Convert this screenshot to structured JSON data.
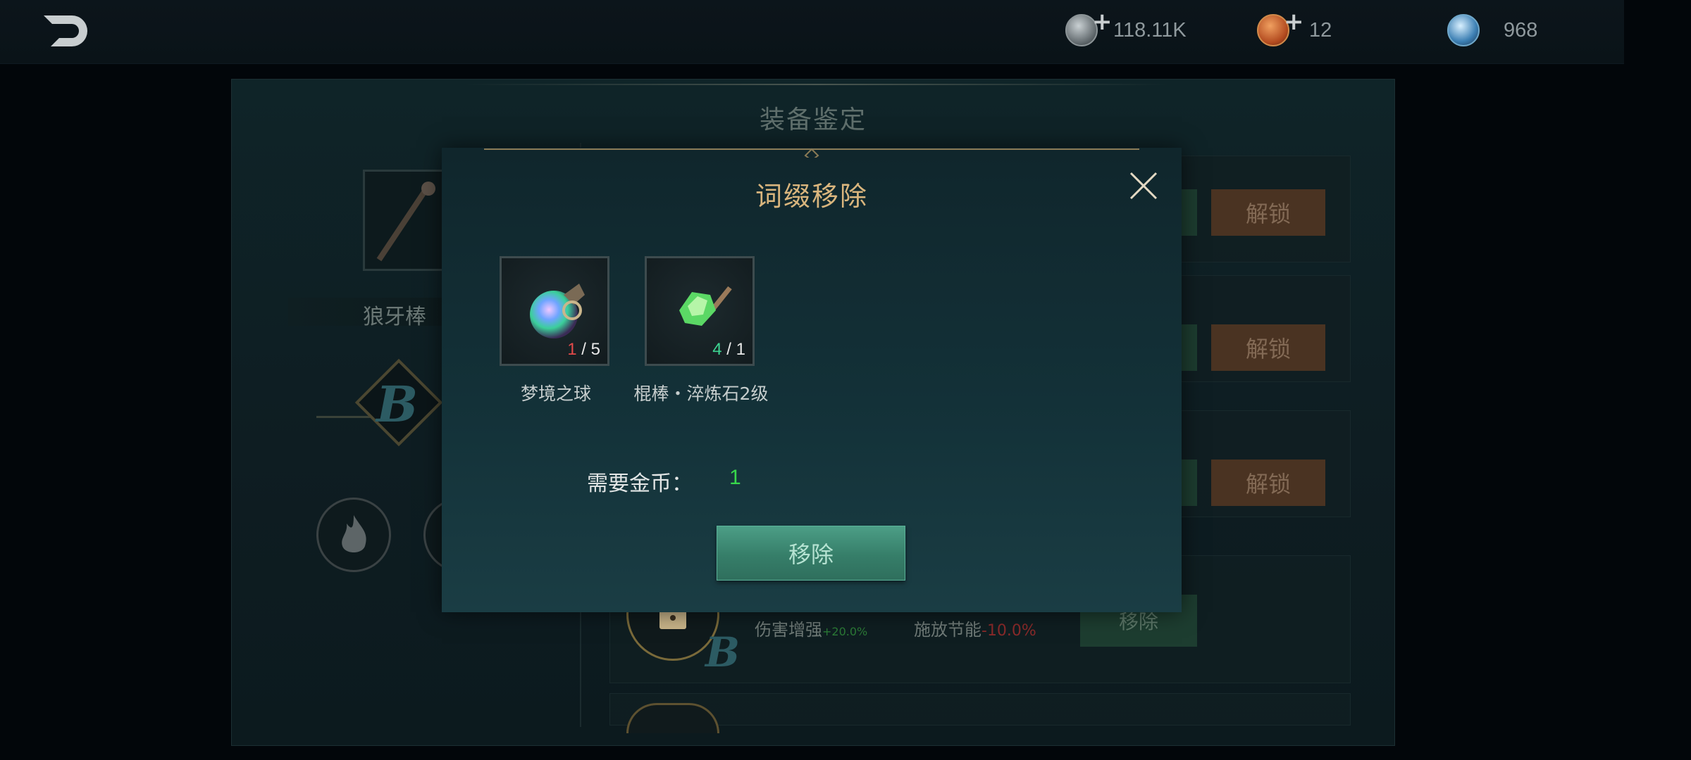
{
  "topbar": {
    "back_icon": "back-arrow-icon",
    "resources": [
      {
        "icon": "silver-coin-icon",
        "value": "118.11K",
        "has_plus": true,
        "plus": "+"
      },
      {
        "icon": "copper-coin-icon",
        "value": "12",
        "has_plus": true,
        "plus": "+"
      },
      {
        "icon": "crystal-orb-icon",
        "value": "968",
        "has_plus": false
      }
    ]
  },
  "background_panel": {
    "title": "装备鉴定",
    "weapon_name": "狼牙棒",
    "grade_letter": "B",
    "unlock_label": "解锁",
    "remove_label": "移除",
    "stat_damage": "伤害增强",
    "stat_damage_value": "+20.0%",
    "stat_cast": "施放节能",
    "stat_cast_value": "-10.0%"
  },
  "modal": {
    "title": "词缀移除",
    "close_icon": "close-icon",
    "items": [
      {
        "name": "梦境之球",
        "have": "1",
        "need": "5",
        "icon": "dream-orb-icon"
      },
      {
        "name": "棍棒・淬炼石2级",
        "have": "4",
        "need": "1",
        "icon": "green-refine-stone-icon"
      }
    ],
    "cost_label": "需要金币：",
    "cost_value": "1",
    "remove_button": "移除"
  },
  "colors": {
    "title_gold": "#d9b57d",
    "cost_green": "#38d84b",
    "count_red": "#e24a4a",
    "count_green": "#3dd592",
    "button_teal": "#3f8f78"
  }
}
